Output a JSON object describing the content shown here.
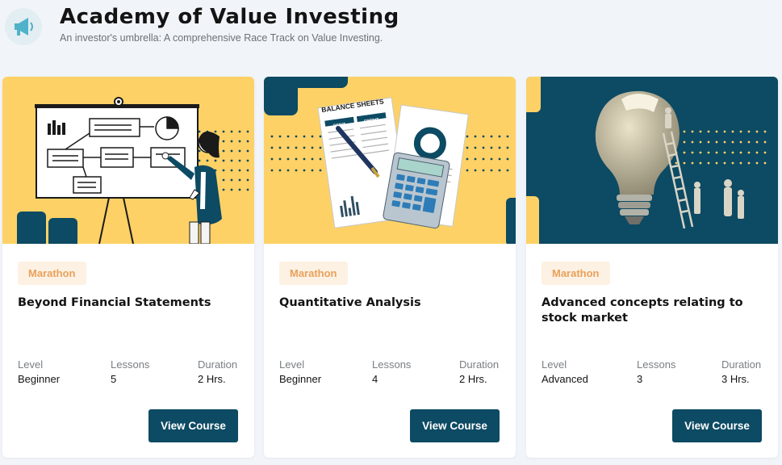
{
  "header": {
    "icon": "megaphone-icon",
    "title": "Academy of Value Investing",
    "subtitle": "An investor's umbrella: A comprehensive Race Track on Value Investing."
  },
  "meta_labels": {
    "level": "Level",
    "lessons": "Lessons",
    "duration": "Duration"
  },
  "colors": {
    "accent": "#0d4a63",
    "yellow": "#fdd166",
    "badge_bg": "#fdf1e3",
    "badge_text": "#e8a15c"
  },
  "courses": [
    {
      "badge": "Marathon",
      "title": "Beyond Financial Statements",
      "level": "Beginner",
      "lessons": "5",
      "duration": "2 Hrs.",
      "button": "View Course",
      "image": "presentation-whiteboard-illustration"
    },
    {
      "badge": "Marathon",
      "title": "Quantitative Analysis",
      "level": "Beginner",
      "lessons": "4",
      "duration": "2 Hrs.",
      "button": "View Course",
      "image": "balance-sheets-calculator-illustration",
      "image_text": {
        "heading": "BALANCE SHEETS",
        "col_left": "DEBIT",
        "col_right": "CREDIT"
      }
    },
    {
      "badge": "Marathon",
      "title": "Advanced concepts relating to stock market",
      "level": "Advanced",
      "lessons": "3",
      "duration": "3 Hrs.",
      "button": "View Course",
      "image": "lightbulb-ladder-illustration"
    }
  ]
}
